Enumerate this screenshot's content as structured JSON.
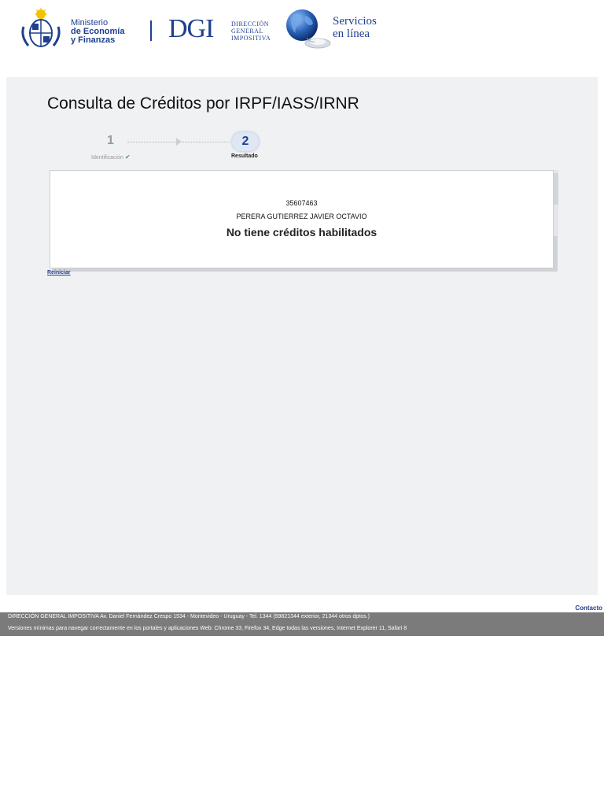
{
  "header": {
    "ministry": {
      "line1": "Ministerio",
      "line2": "de Economía",
      "line3": "y Finanzas"
    },
    "dgi": {
      "abbr": "DGI",
      "line1": "DIRECCIÓN",
      "line2": "GENERAL",
      "line3": "IMPOSITIVA"
    },
    "services": {
      "line1": "Servicios",
      "line2": "en línea"
    }
  },
  "page": {
    "title": "Consulta de Créditos por IRPF/IASS/IRNR"
  },
  "stepper": {
    "steps": [
      {
        "number": "1",
        "label": "Identificación"
      },
      {
        "number": "2",
        "label": "Resultado"
      }
    ]
  },
  "result": {
    "rut": "35607463",
    "name": "PERERA GUTIERREZ JAVIER OCTAVIO",
    "message": "No tiene créditos habilitados"
  },
  "links": {
    "restart": "Reiniciar",
    "contact": "Contacto"
  },
  "footer": {
    "line1": "DIRECCIÓN GENERAL IMPOSITIVA Av. Daniel Fernández Crespo 1534 - Montevideo - Uruguay - Tel. 1344 (59821344 exterior, 21344 otros dptos.)",
    "line2": "Versiones mínimas para navegar correctamente en los portales y aplicaciones Web: Chrome 33, Firefox 34, Edge todas las versiones, Internet Explorer 11, Safari 8"
  },
  "colors": {
    "brand": "#1f3f8f",
    "panel": "#f0f1f3",
    "footer": "#7b7b7b",
    "check": "#3aa14a"
  }
}
